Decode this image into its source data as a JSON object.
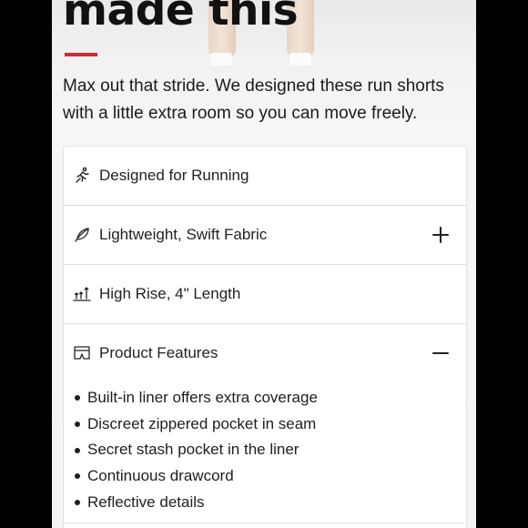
{
  "hero": {
    "headline": "made this",
    "intro": "Max out that stride. We designed these run shorts with a little extra room so you can move freely.",
    "accent_color": "#d7282f"
  },
  "accordion": {
    "items": [
      {
        "label": "Designed for Running",
        "icon": "running-person-icon",
        "toggle": null
      },
      {
        "label": "Lightweight, Swift Fabric",
        "icon": "feather-icon",
        "toggle": "plus"
      },
      {
        "label": "High Rise, 4\" Length",
        "icon": "rise-length-icon",
        "toggle": null
      },
      {
        "label": "Product Features",
        "icon": "shorts-icon",
        "toggle": "minus",
        "expanded": true
      }
    ],
    "features": [
      "Built-in liner offers extra coverage",
      "Discreet zippered pocket in seam",
      "Secret stash pocket in the liner",
      "Continuous drawcord",
      "Reflective details"
    ]
  }
}
